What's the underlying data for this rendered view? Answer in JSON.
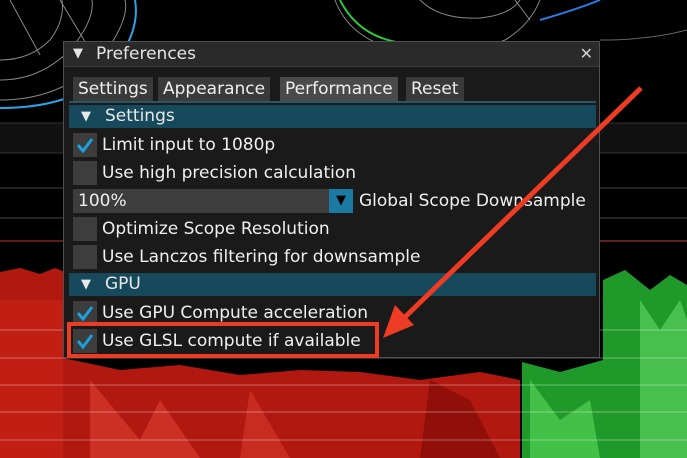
{
  "window": {
    "title": "Preferences",
    "close_glyph": "✕"
  },
  "tabs": [
    {
      "label": "Settings"
    },
    {
      "label": "Appearance"
    },
    {
      "label": "Performance",
      "active": true
    },
    {
      "label": "Reset"
    }
  ],
  "sections": {
    "settings": {
      "label": "Settings",
      "items": [
        {
          "label": "Limit input to 1080p",
          "checked": true
        },
        {
          "label": "Use high precision calculation",
          "checked": false
        }
      ],
      "downsample": {
        "value": "100%",
        "label": "Global Scope Downsample"
      },
      "items2": [
        {
          "label": "Optimize Scope Resolution",
          "checked": false
        },
        {
          "label": "Use Lanczos filtering for downsample",
          "checked": false
        }
      ]
    },
    "gpu": {
      "label": "GPU",
      "items": [
        {
          "label": "Use GPU Compute acceleration",
          "checked": true
        },
        {
          "label": "Use GLSL compute if available",
          "checked": true
        }
      ]
    }
  },
  "colors": {
    "accent": "#1a7aa3",
    "section_header": "#17495c",
    "annotation": "#ee3b24"
  },
  "icons": {
    "collapse": "triangle-down-icon",
    "check": "checkmark-icon",
    "dropdown": "dropdown-arrow-icon"
  }
}
